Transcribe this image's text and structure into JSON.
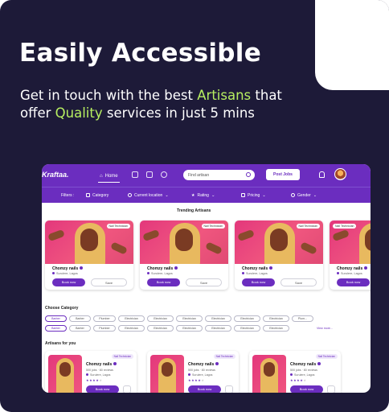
{
  "hero": {
    "title": "Easily Accessible",
    "subtitle_parts": [
      "Get in touch with the best ",
      "Artisans",
      " that offer ",
      "Quality",
      " services in just 5 mins"
    ],
    "accent_color": "#b7ef61",
    "background_color": "#1d1a38"
  },
  "app": {
    "brand": "Kraftaa.",
    "brand_color": "#6b2dbf",
    "nav": {
      "home_label": "Home"
    },
    "search": {
      "placeholder": "Find artisan"
    },
    "post_jobs_label": "Post Jobs",
    "filters": {
      "label": "Filters :",
      "items": [
        "Category",
        "Current location",
        "Rating",
        "Pricing",
        "Gender"
      ]
    },
    "trending": {
      "title": "Trending Artisans",
      "cards": [
        {
          "tag": "Nail Technician",
          "name": "Chomzy nails",
          "location": "Surulere, Lagos",
          "book": "Book now",
          "save": "Save"
        },
        {
          "tag": "Nail Technician",
          "name": "Chomzy nails",
          "location": "Surulere, Lagos",
          "book": "Book now",
          "save": "Save"
        },
        {
          "tag": "Nail Technician",
          "name": "Chomzy nails",
          "location": "Surulere, Lagos",
          "book": "Book now",
          "save": "Save"
        },
        {
          "tag": "Nail Technician",
          "name": "Chomzy nails",
          "location": "Surulere, Lagos",
          "book": "Book now",
          "save": "Save"
        }
      ]
    },
    "categories": {
      "title": "Choose Category",
      "row1": [
        "Barber",
        "Barber",
        "Plumber",
        "Electrician",
        "Electrician",
        "Electrician",
        "Electrician",
        "Electrician",
        "Electrician",
        "Plum..."
      ],
      "row2": [
        "Barber",
        "Barber",
        "Plumber",
        "Electrician",
        "Electrician",
        "Electrician",
        "Electrician",
        "Electrician",
        "Electrician"
      ],
      "view_more": "View more..."
    },
    "for_you": {
      "title": "Artisans for you",
      "cards": [
        {
          "tag": "Nail Technician",
          "name": "Chomzy nails",
          "jobs": "500 jobs",
          "reviews": "80 reviews",
          "location": "Surulere, Lagos",
          "book": "Book now"
        },
        {
          "tag": "Nail Technician",
          "name": "Chomzy nails",
          "jobs": "500 jobs",
          "reviews": "80 reviews",
          "location": "Surulere, Lagos",
          "book": "Book now"
        },
        {
          "tag": "Nail Technician",
          "name": "Chomzy nails",
          "jobs": "500 jobs",
          "reviews": "80 reviews",
          "location": "Surulere, Lagos",
          "book": "Book now"
        }
      ]
    }
  }
}
